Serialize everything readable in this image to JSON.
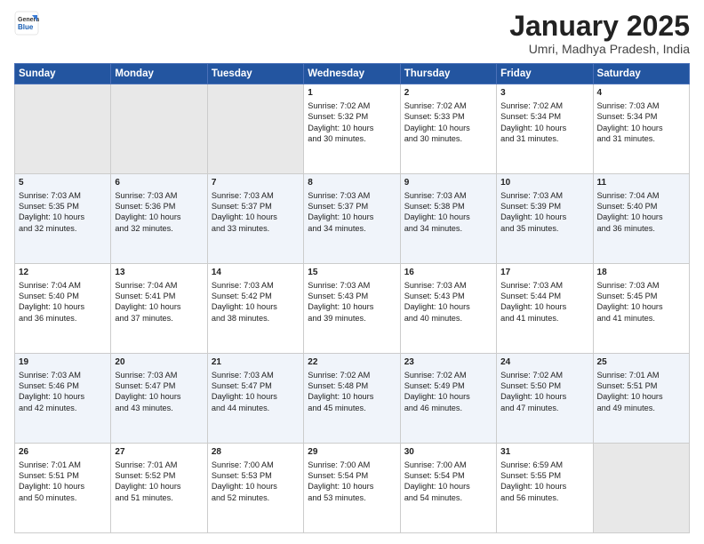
{
  "header": {
    "logo_line1": "General",
    "logo_line2": "Blue",
    "month_title": "January 2025",
    "location": "Umri, Madhya Pradesh, India"
  },
  "days_of_week": [
    "Sunday",
    "Monday",
    "Tuesday",
    "Wednesday",
    "Thursday",
    "Friday",
    "Saturday"
  ],
  "weeks": [
    [
      {
        "day": "",
        "content": ""
      },
      {
        "day": "",
        "content": ""
      },
      {
        "day": "",
        "content": ""
      },
      {
        "day": "1",
        "content": "Sunrise: 7:02 AM\nSunset: 5:32 PM\nDaylight: 10 hours\nand 30 minutes."
      },
      {
        "day": "2",
        "content": "Sunrise: 7:02 AM\nSunset: 5:33 PM\nDaylight: 10 hours\nand 30 minutes."
      },
      {
        "day": "3",
        "content": "Sunrise: 7:02 AM\nSunset: 5:34 PM\nDaylight: 10 hours\nand 31 minutes."
      },
      {
        "day": "4",
        "content": "Sunrise: 7:03 AM\nSunset: 5:34 PM\nDaylight: 10 hours\nand 31 minutes."
      }
    ],
    [
      {
        "day": "5",
        "content": "Sunrise: 7:03 AM\nSunset: 5:35 PM\nDaylight: 10 hours\nand 32 minutes."
      },
      {
        "day": "6",
        "content": "Sunrise: 7:03 AM\nSunset: 5:36 PM\nDaylight: 10 hours\nand 32 minutes."
      },
      {
        "day": "7",
        "content": "Sunrise: 7:03 AM\nSunset: 5:37 PM\nDaylight: 10 hours\nand 33 minutes."
      },
      {
        "day": "8",
        "content": "Sunrise: 7:03 AM\nSunset: 5:37 PM\nDaylight: 10 hours\nand 34 minutes."
      },
      {
        "day": "9",
        "content": "Sunrise: 7:03 AM\nSunset: 5:38 PM\nDaylight: 10 hours\nand 34 minutes."
      },
      {
        "day": "10",
        "content": "Sunrise: 7:03 AM\nSunset: 5:39 PM\nDaylight: 10 hours\nand 35 minutes."
      },
      {
        "day": "11",
        "content": "Sunrise: 7:04 AM\nSunset: 5:40 PM\nDaylight: 10 hours\nand 36 minutes."
      }
    ],
    [
      {
        "day": "12",
        "content": "Sunrise: 7:04 AM\nSunset: 5:40 PM\nDaylight: 10 hours\nand 36 minutes."
      },
      {
        "day": "13",
        "content": "Sunrise: 7:04 AM\nSunset: 5:41 PM\nDaylight: 10 hours\nand 37 minutes."
      },
      {
        "day": "14",
        "content": "Sunrise: 7:03 AM\nSunset: 5:42 PM\nDaylight: 10 hours\nand 38 minutes."
      },
      {
        "day": "15",
        "content": "Sunrise: 7:03 AM\nSunset: 5:43 PM\nDaylight: 10 hours\nand 39 minutes."
      },
      {
        "day": "16",
        "content": "Sunrise: 7:03 AM\nSunset: 5:43 PM\nDaylight: 10 hours\nand 40 minutes."
      },
      {
        "day": "17",
        "content": "Sunrise: 7:03 AM\nSunset: 5:44 PM\nDaylight: 10 hours\nand 41 minutes."
      },
      {
        "day": "18",
        "content": "Sunrise: 7:03 AM\nSunset: 5:45 PM\nDaylight: 10 hours\nand 41 minutes."
      }
    ],
    [
      {
        "day": "19",
        "content": "Sunrise: 7:03 AM\nSunset: 5:46 PM\nDaylight: 10 hours\nand 42 minutes."
      },
      {
        "day": "20",
        "content": "Sunrise: 7:03 AM\nSunset: 5:47 PM\nDaylight: 10 hours\nand 43 minutes."
      },
      {
        "day": "21",
        "content": "Sunrise: 7:03 AM\nSunset: 5:47 PM\nDaylight: 10 hours\nand 44 minutes."
      },
      {
        "day": "22",
        "content": "Sunrise: 7:02 AM\nSunset: 5:48 PM\nDaylight: 10 hours\nand 45 minutes."
      },
      {
        "day": "23",
        "content": "Sunrise: 7:02 AM\nSunset: 5:49 PM\nDaylight: 10 hours\nand 46 minutes."
      },
      {
        "day": "24",
        "content": "Sunrise: 7:02 AM\nSunset: 5:50 PM\nDaylight: 10 hours\nand 47 minutes."
      },
      {
        "day": "25",
        "content": "Sunrise: 7:01 AM\nSunset: 5:51 PM\nDaylight: 10 hours\nand 49 minutes."
      }
    ],
    [
      {
        "day": "26",
        "content": "Sunrise: 7:01 AM\nSunset: 5:51 PM\nDaylight: 10 hours\nand 50 minutes."
      },
      {
        "day": "27",
        "content": "Sunrise: 7:01 AM\nSunset: 5:52 PM\nDaylight: 10 hours\nand 51 minutes."
      },
      {
        "day": "28",
        "content": "Sunrise: 7:00 AM\nSunset: 5:53 PM\nDaylight: 10 hours\nand 52 minutes."
      },
      {
        "day": "29",
        "content": "Sunrise: 7:00 AM\nSunset: 5:54 PM\nDaylight: 10 hours\nand 53 minutes."
      },
      {
        "day": "30",
        "content": "Sunrise: 7:00 AM\nSunset: 5:54 PM\nDaylight: 10 hours\nand 54 minutes."
      },
      {
        "day": "31",
        "content": "Sunrise: 6:59 AM\nSunset: 5:55 PM\nDaylight: 10 hours\nand 56 minutes."
      },
      {
        "day": "",
        "content": ""
      }
    ]
  ]
}
